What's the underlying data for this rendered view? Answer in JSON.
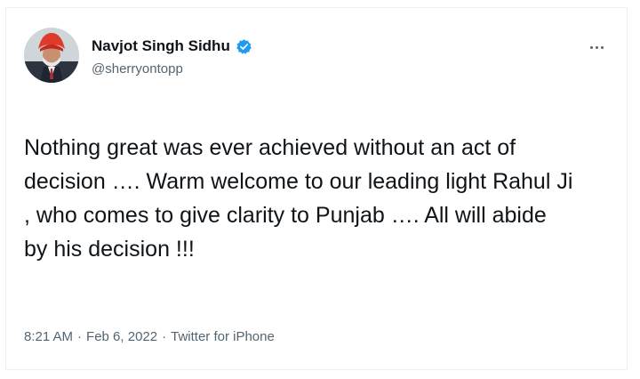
{
  "author": {
    "display_name": "Navjot Singh Sidhu",
    "handle": "@sherryontopp",
    "verified": true,
    "avatar_icon": "profile-photo-turban",
    "verified_color": "#1d9bf0"
  },
  "tweet": {
    "text": "Nothing great was ever achieved without an act of\ndecision …. Warm welcome to our leading light Rahul Ji\n, who comes to give clarity to Punjab …. All will abide\nby his decision !!!",
    "time": "8:21 AM",
    "separator": "·",
    "date": "Feb 6, 2022",
    "source": "Twitter for iPhone"
  },
  "menu": {
    "icon": "more-horizontal-icon"
  }
}
